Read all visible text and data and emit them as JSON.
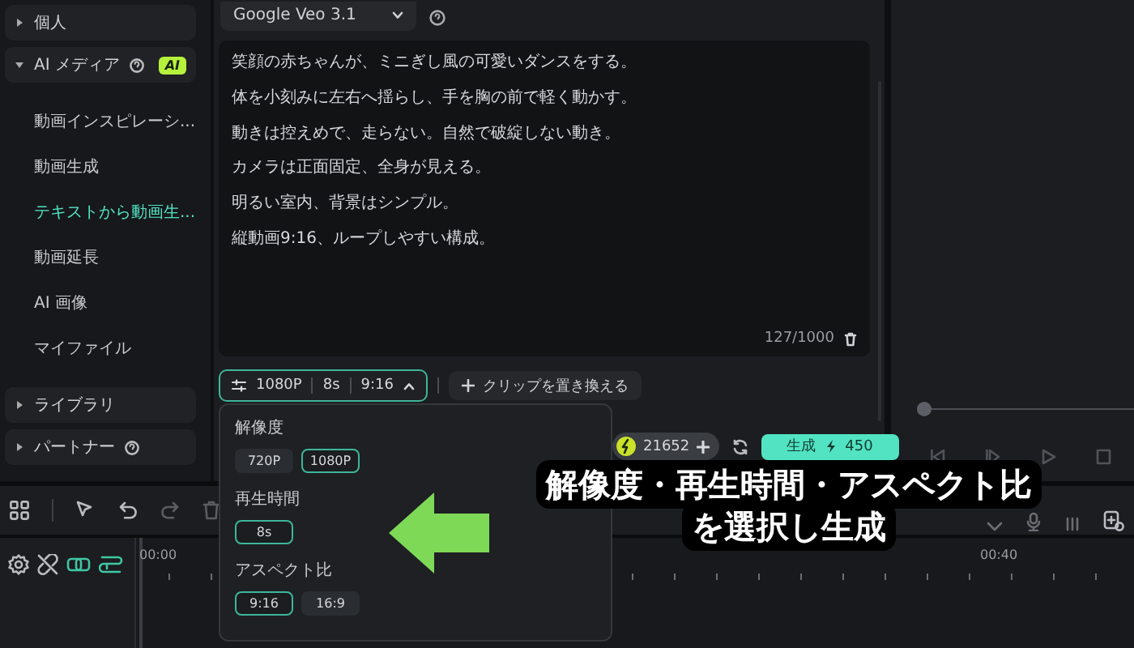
{
  "sidebar": {
    "items": [
      {
        "label": "個人",
        "expanded": false,
        "help": false
      },
      {
        "label": "AI メディア",
        "expanded": true,
        "help": true,
        "badge": "AI",
        "children": [
          {
            "label": "動画インスピレーシ...",
            "selected": false
          },
          {
            "label": "動画生成",
            "selected": false
          },
          {
            "label": "テキストから動画生...",
            "selected": true
          },
          {
            "label": "動画延長",
            "selected": false
          },
          {
            "label": "AI 画像",
            "selected": false
          },
          {
            "label": "マイファイル",
            "selected": false
          }
        ]
      },
      {
        "label": "ライブラリ",
        "expanded": false,
        "help": false
      },
      {
        "label": "パートナー",
        "expanded": false,
        "help": true
      }
    ]
  },
  "model_selector": {
    "value": "Google Veo 3.1"
  },
  "prompt": {
    "lines": [
      "笑顔の赤ちゃんが、ミニぎし風の可愛いダンスをする。",
      "体を小刻みに左右へ揺らし、手を胸の前で軽く動かす。",
      "動きは控えめで、走らない。自然で破綻しない動き。",
      "カメラは正面固定、全身が見える。",
      "明るい室内、背景はシンプル。",
      "縦動画9:16、ループしやすい構成。"
    ],
    "counter": "127/1000"
  },
  "settings_button": {
    "segments": [
      "1080P",
      "8s",
      "9:16"
    ],
    "expanded": true
  },
  "replace_clip_button": {
    "label": "クリップを置き換える"
  },
  "credits": {
    "value": "21652"
  },
  "generate_button": {
    "label": "生成",
    "cost": "450"
  },
  "settings_popup": {
    "sections": [
      {
        "title": "解像度",
        "options": [
          {
            "label": "720P",
            "selected": false
          },
          {
            "label": "1080P",
            "selected": true
          }
        ]
      },
      {
        "title": "再生時間",
        "options": [
          {
            "label": "8s",
            "selected": true
          }
        ]
      },
      {
        "title": "アスペクト比",
        "options": [
          {
            "label": "9:16",
            "selected": true
          },
          {
            "label": "16:9",
            "selected": false
          }
        ]
      }
    ]
  },
  "preview": {
    "level": 0
  },
  "timeline": {
    "ruler_labels": [
      "00:00",
      "00:40"
    ]
  },
  "callout": {
    "lines": [
      "解像度・再生時間・アスペクト比",
      "を選択し生成"
    ]
  }
}
